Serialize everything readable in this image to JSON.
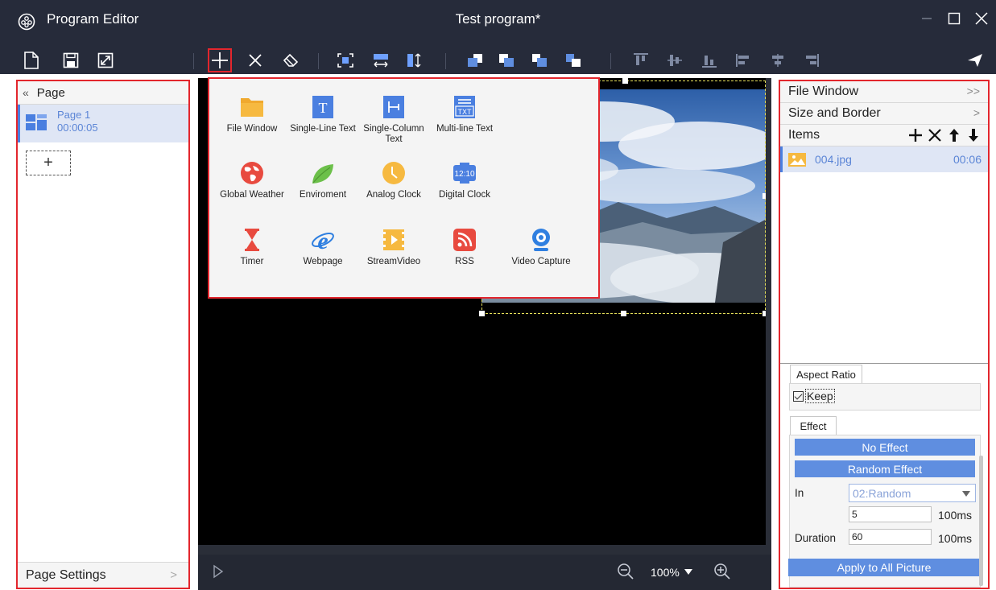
{
  "window": {
    "app_title": "Program Editor",
    "doc_title": "Test program*"
  },
  "icons": {
    "app": "program-editor-icon",
    "minimize": "minimize-icon",
    "maximize": "maximize-icon",
    "close": "close-icon"
  },
  "toolbar": {
    "items": [
      "new-file-icon",
      "save-icon",
      "expand-icon",
      "add-icon",
      "delete-icon",
      "clear-icon",
      "fit-icon",
      "fit-width-icon",
      "fit-height-icon",
      "bring-front-icon",
      "send-back-icon",
      "move-up-icon",
      "move-down-icon",
      "align-top-icon",
      "align-vcenter-icon",
      "align-bottom-icon",
      "align-left-icon",
      "align-hcenter-icon",
      "align-right-icon",
      "send-icon"
    ]
  },
  "left_panel": {
    "header": "Page",
    "collapse_glyph": "«",
    "page_name": "Page 1",
    "page_duration": "00:00:05",
    "add_glyph": "+",
    "footer": "Page Settings",
    "footer_arrow": ">"
  },
  "popup": {
    "items": [
      {
        "label": "File Window",
        "icon": "folder-icon"
      },
      {
        "label": "Single-Line Text",
        "icon": "single-line-text-icon"
      },
      {
        "label": "Single-Column Text",
        "icon": "single-column-text-icon"
      },
      {
        "label": "Multi-line Text",
        "icon": "multi-line-text-icon"
      },
      {
        "label": "Global Weather",
        "icon": "global-weather-icon"
      },
      {
        "label": "Enviroment",
        "icon": "environment-leaf-icon"
      },
      {
        "label": "Analog Clock",
        "icon": "analog-clock-icon"
      },
      {
        "label": "Digital Clock",
        "icon": "digital-clock-icon"
      },
      {
        "label": "Timer",
        "icon": "hourglass-icon"
      },
      {
        "label": "Webpage",
        "icon": "webpage-icon"
      },
      {
        "label": "StreamVideo",
        "icon": "stream-video-icon"
      },
      {
        "label": "RSS",
        "icon": "rss-icon"
      },
      {
        "label": "Video Capture",
        "icon": "webcam-icon"
      }
    ],
    "digital_clock_text": "12:10",
    "txt_icon_text": "TXT",
    "t_icon_text": "T"
  },
  "canvas": {
    "zoom": "100%"
  },
  "right_panel": {
    "file_window": "File Window",
    "file_window_arrow": ">>",
    "size_and_border": "Size and Border",
    "size_arrow": ">",
    "items": "Items",
    "file_name": "004.jpg",
    "file_duration": "00:06",
    "aspect_tab": "Aspect Ratio",
    "keep": "Keep",
    "effect_tab": "Effect",
    "no_effect": "No Effect",
    "random_effect": "Random Effect",
    "in_label": "In",
    "in_value": "02:Random",
    "speed_value": "5",
    "speed_unit": "100ms",
    "duration_label": "Duration",
    "duration_value": "60",
    "duration_unit": "100ms",
    "apply_all": "Apply to All Picture"
  },
  "colors": {
    "titlebar": "#262b3a",
    "highlight_border": "#e3262d",
    "accent_blue": "#5f8ee0",
    "selection_bg": "#dfe6f5"
  }
}
